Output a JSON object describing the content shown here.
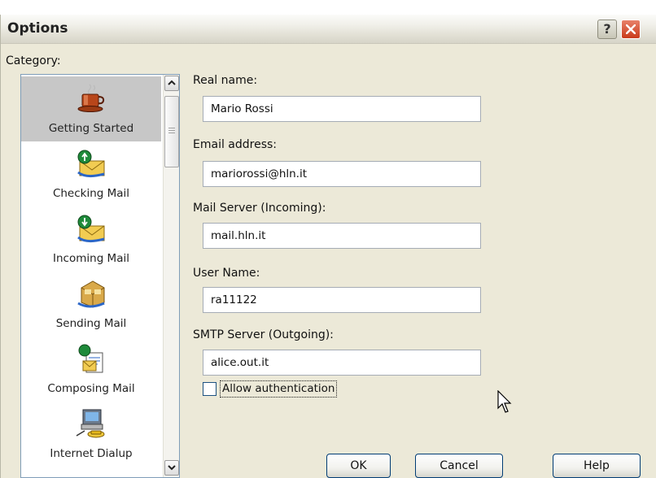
{
  "window": {
    "title": "Options",
    "help_glyph": "?"
  },
  "category": {
    "label": "Category:",
    "items": [
      {
        "label": "Getting Started",
        "icon": "coffee-cup-icon",
        "selected": true
      },
      {
        "label": "Checking Mail",
        "icon": "mail-check-icon",
        "selected": false
      },
      {
        "label": "Incoming Mail",
        "icon": "mail-incoming-icon",
        "selected": false
      },
      {
        "label": "Sending Mail",
        "icon": "mail-send-icon",
        "selected": false
      },
      {
        "label": "Composing Mail",
        "icon": "compose-mail-icon",
        "selected": false
      },
      {
        "label": "Internet Dialup",
        "icon": "dialup-computer-icon",
        "selected": false
      }
    ]
  },
  "form": {
    "real_name": {
      "label": "Real name:",
      "value": "Mario Rossi"
    },
    "email": {
      "label": "Email address:",
      "value": "mariorossi@hln.it"
    },
    "incoming": {
      "label": "Mail Server (Incoming):",
      "value": "mail.hln.it"
    },
    "username": {
      "label": "User Name:",
      "value": "ra11122"
    },
    "smtp": {
      "label": "SMTP Server (Outgoing):",
      "value": "alice.out.it"
    },
    "auth": {
      "label": "Allow authentication",
      "checked": false
    }
  },
  "buttons": {
    "ok": "OK",
    "cancel": "Cancel",
    "help": "Help"
  },
  "colors": {
    "dialog_bg": "#ece9d8",
    "selected_item": "#c7c7c7",
    "button_border": "#003c74",
    "close_red": "#c93a1a"
  }
}
